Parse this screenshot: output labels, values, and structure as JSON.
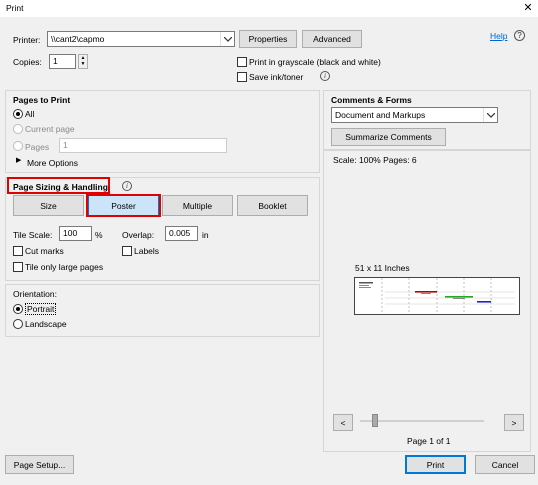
{
  "window": {
    "title": "Print",
    "close_glyph": "✕"
  },
  "printer": {
    "label": "Printer:",
    "value": "\\\\cant2\\capmo",
    "properties_label": "Properties",
    "advanced_label": "Advanced",
    "help_label": "Help",
    "copies_label": "Copies:",
    "copies_value": "1",
    "grayscale_label": "Print in grayscale (black and white)",
    "grayscale_checked": false,
    "save_ink_label": "Save ink/toner",
    "save_ink_checked": false
  },
  "pages_to_print": {
    "heading": "Pages to Print",
    "all_label": "All",
    "current_page_label": "Current page",
    "pages_label": "Pages",
    "pages_value": "1",
    "more_options_label": "More Options"
  },
  "page_sizing": {
    "heading": "Page Sizing & Handling",
    "tabs": [
      "Size",
      "Poster",
      "Multiple",
      "Booklet"
    ],
    "selected_tab": "Poster",
    "tile_scale_label": "Tile Scale:",
    "tile_scale_value": "100",
    "percent_label": "%",
    "overlap_label": "Overlap:",
    "overlap_value": "0.005",
    "overlap_unit": "in",
    "cut_marks_label": "Cut marks",
    "labels_label": "Labels",
    "tile_large_label": "Tile only large pages"
  },
  "orientation": {
    "heading": "Orientation:",
    "portrait_label": "Portrait",
    "landscape_label": "Landscape",
    "selected": "Portrait"
  },
  "comments_forms": {
    "heading": "Comments & Forms",
    "value": "Document and Markups",
    "summarize_label": "Summarize Comments"
  },
  "preview": {
    "scale_text": "Scale: 100% Pages: 6",
    "size_text": "51 x 11 Inches",
    "prev_glyph": "<",
    "next_glyph": ">",
    "page_text": "Page 1 of 1"
  },
  "footer": {
    "page_setup_label": "Page Setup...",
    "print_label": "Print",
    "cancel_label": "Cancel"
  },
  "colors": {
    "accent": "#0078d7",
    "highlight_box": "#e00000",
    "link": "#0066cc"
  }
}
